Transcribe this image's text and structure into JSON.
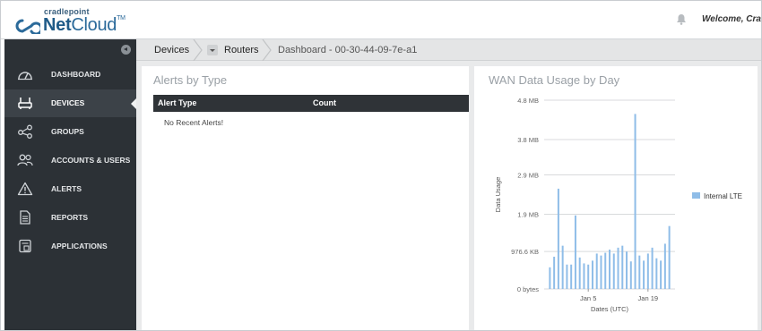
{
  "header": {
    "logo_small": "cradlepoint",
    "logo_net": "Net",
    "logo_cloud": "Cloud",
    "logo_tm": "TM",
    "welcome": "Welcome, Cradl"
  },
  "sidebar": {
    "items": [
      {
        "label": "DASHBOARD",
        "icon": "gauge-icon"
      },
      {
        "label": "DEVICES",
        "icon": "router-icon",
        "active": true
      },
      {
        "label": "GROUPS",
        "icon": "share-nodes-icon"
      },
      {
        "label": "ACCOUNTS & USERS",
        "icon": "users-icon"
      },
      {
        "label": "ALERTS",
        "icon": "warning-icon"
      },
      {
        "label": "REPORTS",
        "icon": "document-icon"
      },
      {
        "label": "APPLICATIONS",
        "icon": "apps-icon"
      }
    ]
  },
  "breadcrumb": {
    "devices": "Devices",
    "routers": "Routers",
    "current": "Dashboard - 00-30-44-09-7e-a1"
  },
  "alerts": {
    "title": "Alerts by Type",
    "col_type": "Alert Type",
    "col_count": "Count",
    "empty": "No Recent Alerts!"
  },
  "wan": {
    "title": "WAN Data Usage by Day"
  },
  "chart_data": {
    "type": "bar",
    "title": "WAN Data Usage by Day",
    "xlabel": "Dates (UTC)",
    "ylabel": "Data Usage",
    "y_ticks": [
      "0 bytes",
      "976.6 KB",
      "1.9 MB",
      "2.9 MB",
      "3.8 MB",
      "4.8 MB"
    ],
    "y_tick_values_mb": [
      0,
      0.954,
      1.9,
      2.9,
      3.8,
      4.8
    ],
    "ylim_mb": [
      0,
      4.8
    ],
    "x_tick_labels": [
      "Jan 5",
      "Jan 19"
    ],
    "x_tick_positions": [
      9,
      23
    ],
    "grid": true,
    "legend_position": "right",
    "series": [
      {
        "name": "Internal LTE",
        "color": "#8fbde8",
        "values_mb": [
          0.55,
          0.82,
          2.55,
          1.1,
          0.62,
          0.62,
          1.87,
          0.8,
          0.65,
          0.62,
          0.72,
          0.9,
          0.85,
          0.92,
          1.0,
          0.9,
          1.05,
          1.1,
          0.95,
          0.7,
          4.45,
          0.85,
          0.72,
          0.9,
          1.05,
          0.78,
          0.72,
          1.15,
          1.6
        ]
      }
    ]
  }
}
